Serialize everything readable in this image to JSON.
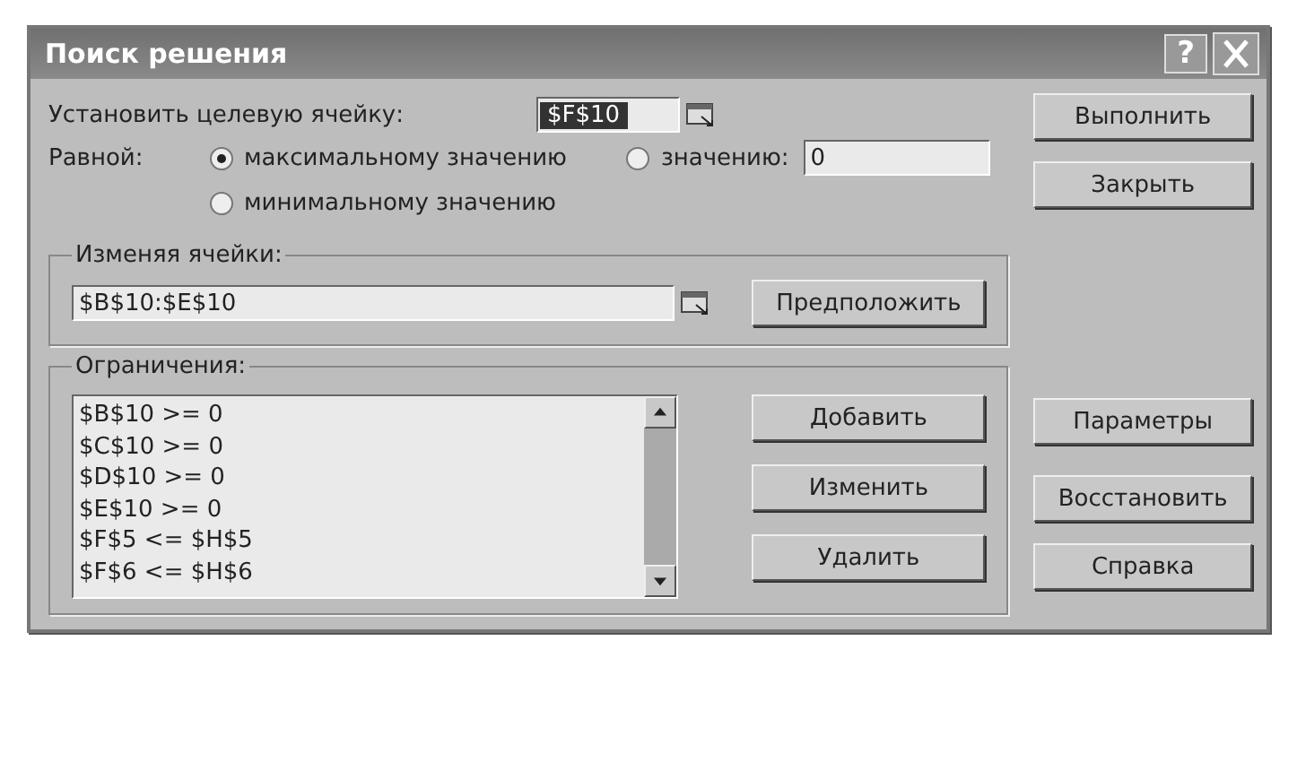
{
  "window": {
    "title": "Поиск решения",
    "help_button": "?"
  },
  "target": {
    "label": "Установить целевую ячейку:",
    "value": "$F$10",
    "selected": true
  },
  "equal_to": {
    "label": "Равной:",
    "options": [
      {
        "label": "максимальному значению",
        "selected": true
      },
      {
        "label": "значению:",
        "selected": false
      },
      {
        "label": "минимальному значению",
        "selected": false
      }
    ],
    "value_field": "0"
  },
  "changing_cells": {
    "label": "Изменяя ячейки:",
    "value": "$B$10:$E$10",
    "button": "Предположить"
  },
  "constraints": {
    "label": "Ограничения:",
    "items": [
      "$B$10 >= 0",
      "$C$10 >= 0",
      "$D$10 >= 0",
      "$E$10 >= 0",
      "$F$5 <= $H$5",
      "$F$6 <= $H$6"
    ],
    "buttons": [
      "Добавить",
      "Изменить",
      "Удалить"
    ]
  },
  "side_buttons": {
    "top": [
      "Выполнить",
      "Закрыть"
    ],
    "middle": "Параметры",
    "bottom": [
      "Восстановить",
      "Справка"
    ]
  }
}
